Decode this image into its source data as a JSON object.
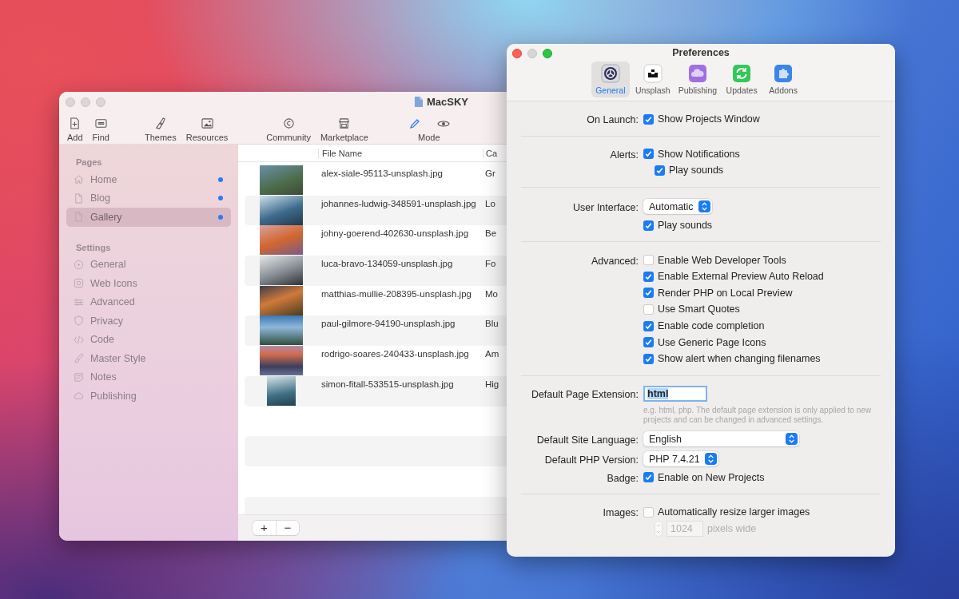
{
  "main_window": {
    "title": "MacSKY",
    "toolbar": {
      "groups": [
        [
          {
            "kind": "add",
            "label": "Add"
          },
          {
            "kind": "find",
            "label": "Find"
          }
        ],
        [
          {
            "kind": "themes",
            "label": "Themes"
          },
          {
            "kind": "resources",
            "label": "Resources"
          }
        ],
        [
          {
            "kind": "community",
            "label": "Community"
          },
          {
            "kind": "marketplace",
            "label": "Marketplace"
          }
        ]
      ],
      "mode": {
        "label": "Mode",
        "options": [
          {
            "kind": "edit",
            "selected": true
          },
          {
            "kind": "preview",
            "selected": false
          }
        ]
      }
    },
    "sidebar": {
      "sections": [
        {
          "title": "Pages",
          "items": [
            {
              "kind": "home",
              "label": "Home",
              "selected": false,
              "modified": true
            },
            {
              "kind": "page",
              "label": "Blog",
              "selected": false,
              "modified": true
            },
            {
              "kind": "page",
              "label": "Gallery",
              "selected": true,
              "modified": true
            }
          ]
        },
        {
          "title": "Settings",
          "items": [
            {
              "kind": "general",
              "label": "General",
              "selected": false,
              "modified": false
            },
            {
              "kind": "webicons",
              "label": "Web Icons",
              "selected": false,
              "modified": false
            },
            {
              "kind": "advanced",
              "label": "Advanced",
              "selected": false,
              "modified": false
            },
            {
              "kind": "privacy",
              "label": "Privacy",
              "selected": false,
              "modified": false
            },
            {
              "kind": "code",
              "label": "Code",
              "selected": false,
              "modified": false
            },
            {
              "kind": "style",
              "label": "Master Style",
              "selected": false,
              "modified": false
            },
            {
              "kind": "notes",
              "label": "Notes",
              "selected": false,
              "modified": false
            },
            {
              "kind": "publishing",
              "label": "Publishing",
              "selected": false,
              "modified": false
            }
          ]
        }
      ]
    },
    "table": {
      "columns": [
        {
          "title": "File Name"
        },
        {
          "title": "Ca"
        }
      ],
      "rows": [
        {
          "file_name": "alex-siale-95113-unsplash.jpg",
          "column_3": "Gr"
        },
        {
          "file_name": "johannes-ludwig-348591-unsplash.jpg",
          "column_3": "Lo"
        },
        {
          "file_name": "johny-goerend-402630-unsplash.jpg",
          "column_3": "Be"
        },
        {
          "file_name": "luca-bravo-134059-unsplash.jpg",
          "column_3": "Fo"
        },
        {
          "file_name": "matthias-mullie-208395-unsplash.jpg",
          "column_3": "Mo"
        },
        {
          "file_name": "paul-gilmore-94190-unsplash.jpg",
          "column_3": "Blu"
        },
        {
          "file_name": "rodrigo-soares-240433-unsplash.jpg",
          "column_3": "Am"
        },
        {
          "file_name": "simon-fitall-533515-unsplash.jpg",
          "column_3": "Hig"
        }
      ]
    },
    "bottom_buttons": [
      "+",
      "−"
    ]
  },
  "preferences": {
    "title": "Preferences",
    "tabs": [
      {
        "kind": "general",
        "label": "General",
        "selected": true
      },
      {
        "kind": "unsplash",
        "label": "Unsplash",
        "selected": false
      },
      {
        "kind": "publishing",
        "label": "Publishing",
        "selected": false
      },
      {
        "kind": "updates",
        "label": "Updates",
        "selected": false
      },
      {
        "kind": "addons",
        "label": "Addons",
        "selected": false
      }
    ],
    "sections": [
      [
        {
          "label": "On Launch:",
          "kind": "checkbox",
          "text": "Show Projects Window",
          "checked": true
        }
      ],
      [
        {
          "label": "Alerts:",
          "kind": "checkbox",
          "text": "Show Notifications",
          "checked": true,
          "children": [
            {
              "kind": "checkbox",
              "text": "Play sounds",
              "checked": true
            }
          ]
        }
      ],
      [
        {
          "label": "User Interface:",
          "kind": "select",
          "value": "Automatic",
          "full_width": false
        },
        {
          "kind": "checkbox",
          "text": "Play sounds",
          "checked": true
        }
      ],
      [
        {
          "label": "Advanced:",
          "kind": "checkbox",
          "text": "Enable Web Developer Tools",
          "checked": false
        },
        {
          "kind": "checkbox",
          "text": "Enable External Preview Auto Reload",
          "checked": true
        },
        {
          "kind": "checkbox",
          "text": "Render PHP on Local Preview",
          "checked": true
        },
        {
          "kind": "checkbox",
          "text": "Use Smart Quotes",
          "checked": false
        },
        {
          "kind": "checkbox",
          "text": "Enable code completion",
          "checked": true
        },
        {
          "kind": "checkbox",
          "text": "Use Generic Page Icons",
          "checked": true
        },
        {
          "kind": "checkbox",
          "text": "Show alert when changing filenames",
          "checked": true
        }
      ],
      [
        {
          "label": "Default Page Extension:",
          "kind": "text_field",
          "value": "html",
          "focused": true,
          "note": "e.g. html, php. The default page extension is only applied to new projects and can be changed in advanced settings."
        },
        {
          "label": "Default Site Language:",
          "kind": "select",
          "value": "English",
          "full_width": true
        },
        {
          "label": "Default PHP Version:",
          "kind": "select",
          "value": "PHP 7.4.21",
          "full_width": false
        },
        {
          "label": "Badge:",
          "kind": "checkbox",
          "text": "Enable on New Projects",
          "checked": true
        }
      ],
      [
        {
          "label": "Images:",
          "kind": "checkbox",
          "text": "Automatically resize larger images",
          "checked": false,
          "children": [
            {
              "kind": "stepper",
              "value": "1024",
              "unit": "pixels wide",
              "disabled": true
            }
          ]
        }
      ]
    ]
  }
}
